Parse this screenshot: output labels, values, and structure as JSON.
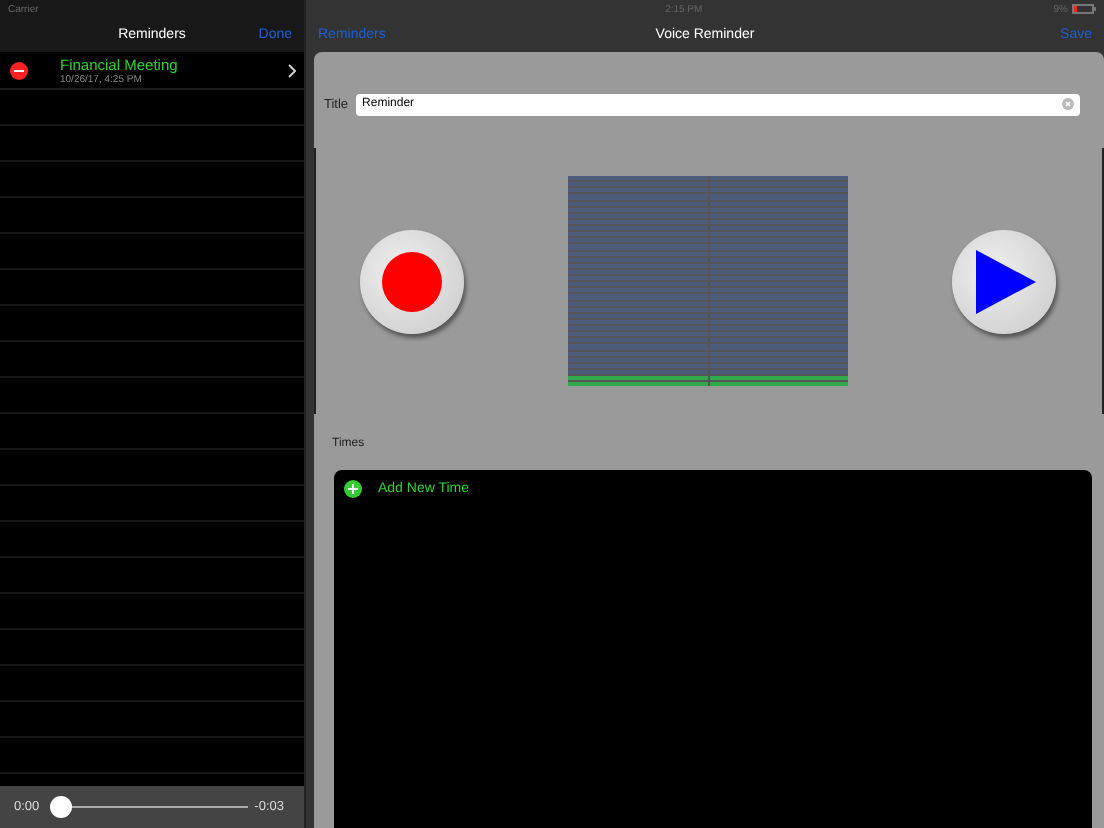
{
  "status_bar": {
    "carrier": "Carrier",
    "time": "2:15 PM",
    "battery": "9%"
  },
  "sidebar": {
    "title": "Reminders",
    "done": "Done",
    "items": [
      {
        "title": "Financial Meeting",
        "subtitle": "10/26/17, 4:25 PM"
      }
    ],
    "player": {
      "elapsed": "0:00",
      "remaining": "-0:03",
      "level": 0
    }
  },
  "detail": {
    "back": "Reminders",
    "title": "Voice Reminder",
    "save": "Save",
    "field": {
      "label": "Title",
      "value": "Reminder"
    },
    "meters": [
      {
        "level": 0.06
      },
      {
        "level": 0.06
      }
    ],
    "times_label": "Times",
    "add_time": "Add New Time"
  }
}
